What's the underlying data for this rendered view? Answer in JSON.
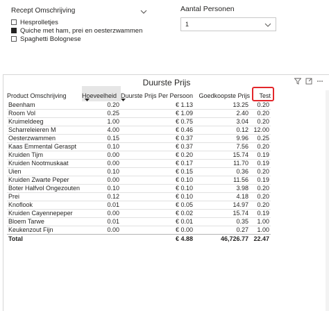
{
  "recept_slicer": {
    "title": "Recept Omschrijving",
    "items": [
      {
        "label": "Hesprolletjes",
        "checked": false
      },
      {
        "label": "Quiche met ham, prei en oesterzwammen",
        "checked": true
      },
      {
        "label": "Spaghetti Bolognese",
        "checked": false
      }
    ]
  },
  "aantal_slicer": {
    "title": "Aantal Personen",
    "value": "1"
  },
  "table_visual": {
    "title": "Duurste Prijs",
    "columns": [
      "Product Omschrijving",
      "Hoeveelheid",
      "Duurste Prijs Per Persoon",
      "Goedkoopste Prijs",
      "Test"
    ],
    "rows": [
      [
        "Beenham",
        "0.20",
        "€ 1.13",
        "13.25",
        "0.20"
      ],
      [
        "Room Vol",
        "0.25",
        "€ 1.09",
        "2.40",
        "0.20"
      ],
      [
        "Kruimeldeeg",
        "1.00",
        "€ 0.75",
        "3.04",
        "0.20"
      ],
      [
        "Scharreleieren M",
        "4.00",
        "€ 0.46",
        "0.12",
        "12.00"
      ],
      [
        "Oesterzwammen",
        "0.15",
        "€ 0.37",
        "9.96",
        "0.25"
      ],
      [
        "Kaas Emmental Geraspt",
        "0.10",
        "€ 0.37",
        "7.56",
        "0.20"
      ],
      [
        "Kruiden Tijm",
        "0.00",
        "€ 0.20",
        "15.74",
        "0.19"
      ],
      [
        "Kruiden Nootmuskaat",
        "0.00",
        "€ 0.17",
        "11.70",
        "0.19"
      ],
      [
        "Uien",
        "0.10",
        "€ 0.15",
        "0.36",
        "0.20"
      ],
      [
        "Kruiden Zwarte Peper",
        "0.00",
        "€ 0.10",
        "11.56",
        "0.19"
      ],
      [
        "Boter Halfvol Ongezouten",
        "0.10",
        "€ 0.10",
        "3.98",
        "0.20"
      ],
      [
        "Prei",
        "0.12",
        "€ 0.10",
        "4.18",
        "0.20"
      ],
      [
        "Knoflook",
        "0.01",
        "€ 0.05",
        "14.97",
        "0.20"
      ],
      [
        "Kruiden Cayennepeper",
        "0.00",
        "€ 0.02",
        "15.74",
        "0.19"
      ],
      [
        "Bloem Tarwe",
        "0.01",
        "€ 0.01",
        "0.35",
        "1.00"
      ],
      [
        "Keukenzout Fijn",
        "0.00",
        "€ 0.00",
        "0.27",
        "1.00"
      ]
    ],
    "total": [
      "Total",
      "",
      "€ 4.88",
      "46,726.77",
      "22.47"
    ]
  },
  "colors": {
    "highlight": "#e3262a",
    "sorted_header_bg": "#e6e6e6"
  },
  "icons": [
    "chevron-down-icon",
    "filter-icon",
    "focus-mode-icon",
    "more-options-icon"
  ]
}
